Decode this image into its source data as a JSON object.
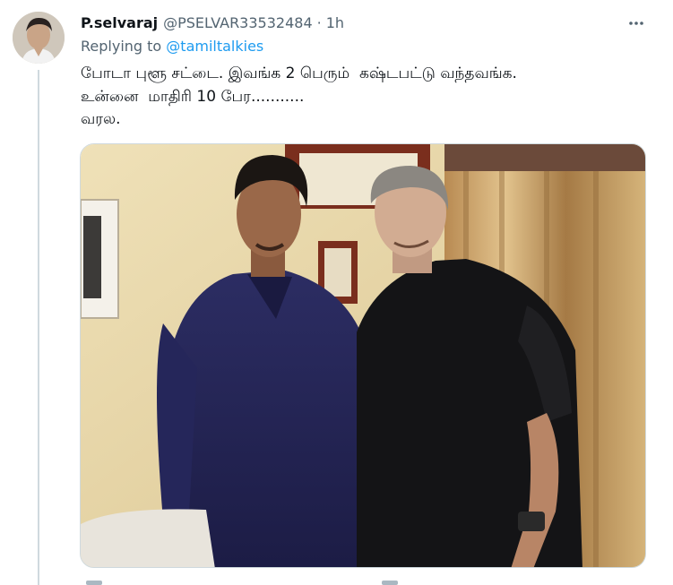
{
  "tweet": {
    "display_name": "P.selvaraj",
    "handle": "@PSELVAR33532484",
    "separator": "·",
    "time": "1h",
    "replying_prefix": "Replying to ",
    "replying_to": "@tamiltalkies",
    "text_lines": [
      "போடா புளூ சட்டை. இவங்க 2 பெரும்  கஷ்டபட்டு வந்தவங்க.",
      "உன்னை  மாதிரி 10 பேர...........",
      "வரல."
    ],
    "more_icon": "⋯"
  },
  "icons": {
    "more": "more-horizontal-icon",
    "avatar": "profile-avatar",
    "photo": "attached-photo"
  },
  "colors": {
    "link": "#1d9bf0",
    "secondary_text": "#536471",
    "border": "#cfd9de"
  }
}
